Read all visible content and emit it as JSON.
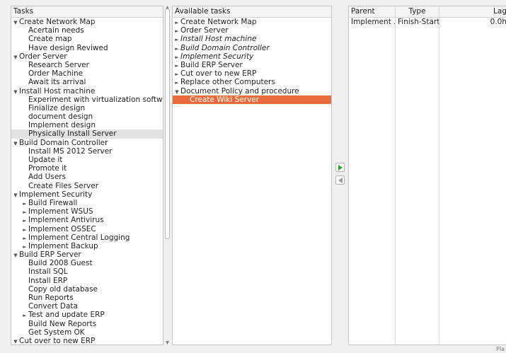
{
  "tasks": {
    "header": "Tasks",
    "items": [
      {
        "label": "Create Network Map",
        "level": 0,
        "toggle": "▼"
      },
      {
        "label": "Acertain needs",
        "level": 1
      },
      {
        "label": "Create map",
        "level": 1
      },
      {
        "label": "Have design Reviwed",
        "level": 1
      },
      {
        "label": "Order Server",
        "level": 0,
        "toggle": "▼"
      },
      {
        "label": "Research Server",
        "level": 1
      },
      {
        "label": "Order Machine",
        "level": 1
      },
      {
        "label": "Await its arrival",
        "level": 1
      },
      {
        "label": "Install Host machine",
        "level": 0,
        "toggle": "▼"
      },
      {
        "label": "Experiment with virtualization software",
        "level": 1
      },
      {
        "label": "Finialize design",
        "level": 1
      },
      {
        "label": "document design",
        "level": 1
      },
      {
        "label": "Implement design",
        "level": 1
      },
      {
        "label": "Physically Install Server",
        "level": 1,
        "selected": true
      },
      {
        "label": "Build Domain Controller",
        "level": 0,
        "toggle": "▼"
      },
      {
        "label": "Install MS 2012 Server",
        "level": 1
      },
      {
        "label": "Update it",
        "level": 1
      },
      {
        "label": "Promote it",
        "level": 1
      },
      {
        "label": "Add Users",
        "level": 1
      },
      {
        "label": "Create Files Server",
        "level": 1
      },
      {
        "label": "Implement Security",
        "level": 0,
        "toggle": "▼"
      },
      {
        "label": "Build Firewall",
        "level": 1,
        "toggle": "►"
      },
      {
        "label": "Implement WSUS",
        "level": 1,
        "toggle": "►"
      },
      {
        "label": "Implement Antivirus",
        "level": 1,
        "toggle": "►"
      },
      {
        "label": "Implement OSSEC",
        "level": 1,
        "toggle": "►"
      },
      {
        "label": "Implement Central Logging",
        "level": 1,
        "toggle": "►"
      },
      {
        "label": "Implement Backup",
        "level": 1,
        "toggle": "►"
      },
      {
        "label": "Build ERP Server",
        "level": 0,
        "toggle": "▼"
      },
      {
        "label": "Build 2008 Guest",
        "level": 1
      },
      {
        "label": "Install SQL",
        "level": 1
      },
      {
        "label": "Install ERP",
        "level": 1
      },
      {
        "label": "Copy old database",
        "level": 1
      },
      {
        "label": "Run Reports",
        "level": 1
      },
      {
        "label": "Convert Data",
        "level": 1
      },
      {
        "label": "Test and update ERP",
        "level": 1,
        "toggle": "►"
      },
      {
        "label": "Build New Reports",
        "level": 1
      },
      {
        "label": "Get System OK",
        "level": 1
      },
      {
        "label": "Cut over to new ERP",
        "level": 0,
        "toggle": "▼"
      }
    ]
  },
  "available": {
    "header": "Available tasks",
    "items": [
      {
        "label": "Create Network Map",
        "level": 0,
        "toggle": "►"
      },
      {
        "label": "Order Server",
        "level": 0,
        "toggle": "►"
      },
      {
        "label": "Install Host machine",
        "level": 0,
        "toggle": "►",
        "italic": true
      },
      {
        "label": "Build Domain Controller",
        "level": 0,
        "toggle": "►",
        "italic": true
      },
      {
        "label": "Implement Security",
        "level": 0,
        "toggle": "►",
        "italic": true
      },
      {
        "label": "Build ERP Server",
        "level": 0,
        "toggle": "►"
      },
      {
        "label": "Cut over to new ERP",
        "level": 0,
        "toggle": "►"
      },
      {
        "label": "Replace other Computers",
        "level": 0,
        "toggle": "►"
      },
      {
        "label": "Document Policy and procedure",
        "level": 0,
        "toggle": "▼"
      },
      {
        "label": "Create Wiki Server",
        "level": 1,
        "highlighted": true
      }
    ]
  },
  "relations": {
    "columns": [
      "Parent",
      "Type",
      "Lag"
    ],
    "rows": [
      {
        "parent": "Implement ...",
        "type": "Finish-Start",
        "lag": "0.0h"
      }
    ]
  },
  "footer": {
    "plan_label": "Pla"
  },
  "colors": {
    "highlight": "#e86d3c",
    "add_arrow": "#2aa32a",
    "remove_arrow": "#9a9a9a"
  },
  "icons": {
    "add": "triangle-right-icon",
    "remove": "triangle-left-icon"
  }
}
